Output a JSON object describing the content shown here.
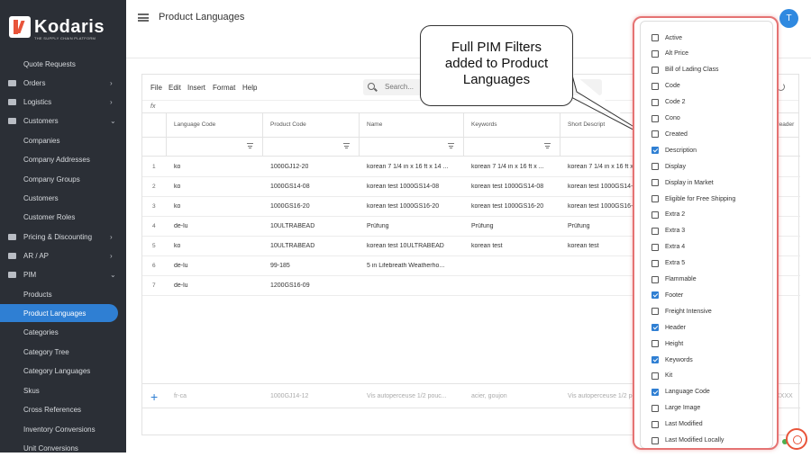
{
  "brand": {
    "name": "Kodaris",
    "tagline": "THE SUPPLY CHAIN PLATFORM",
    "accent": "#2f7fd3",
    "sidebar_bg": "#2b2f36"
  },
  "sidebar": {
    "items": [
      {
        "label": "Quote Requests",
        "icon": "",
        "chevron": "",
        "sub": true
      },
      {
        "label": "Orders",
        "icon": "cart-icon",
        "chevron": "›",
        "sub": false
      },
      {
        "label": "Logistics",
        "icon": "truck-icon",
        "chevron": "›",
        "sub": false
      },
      {
        "label": "Customers",
        "icon": "people-icon",
        "chevron": "⌄",
        "sub": false
      },
      {
        "label": "Companies",
        "icon": "",
        "chevron": "",
        "sub": true
      },
      {
        "label": "Company Addresses",
        "icon": "",
        "chevron": "",
        "sub": true
      },
      {
        "label": "Company Groups",
        "icon": "",
        "chevron": "",
        "sub": true
      },
      {
        "label": "Customers",
        "icon": "",
        "chevron": "",
        "sub": true
      },
      {
        "label": "Customer Roles",
        "icon": "",
        "chevron": "",
        "sub": true
      },
      {
        "label": "Pricing & Discounting",
        "icon": "dollar-icon",
        "chevron": "›",
        "sub": false
      },
      {
        "label": "AR / AP",
        "icon": "ledger-icon",
        "chevron": "›",
        "sub": false
      },
      {
        "label": "PIM",
        "icon": "tag-icon",
        "chevron": "⌄",
        "sub": false
      },
      {
        "label": "Products",
        "icon": "",
        "chevron": "",
        "sub": true
      },
      {
        "label": "Product Languages",
        "icon": "",
        "chevron": "",
        "sub": true,
        "active": true
      },
      {
        "label": "Categories",
        "icon": "",
        "chevron": "",
        "sub": true
      },
      {
        "label": "Category Tree",
        "icon": "",
        "chevron": "",
        "sub": true
      },
      {
        "label": "Category Languages",
        "icon": "",
        "chevron": "",
        "sub": true
      },
      {
        "label": "Skus",
        "icon": "",
        "chevron": "",
        "sub": true
      },
      {
        "label": "Cross References",
        "icon": "",
        "chevron": "",
        "sub": true
      },
      {
        "label": "Inventory Conversions",
        "icon": "",
        "chevron": "",
        "sub": true
      },
      {
        "label": "Unit Conversions",
        "icon": "",
        "chevron": "",
        "sub": true
      }
    ]
  },
  "header": {
    "title": "Product Languages",
    "avatar_initial": "T"
  },
  "toolbar": {
    "menus": [
      "File",
      "Edit",
      "Insert",
      "Format",
      "Help"
    ],
    "search_placeholder": "Search...",
    "fx_label": "fx"
  },
  "table": {
    "columns": [
      "Language Code",
      "Product Code",
      "Name",
      "Keywords",
      "Short Descript",
      "Header"
    ],
    "rows": [
      {
        "num": "1",
        "lang": "ko",
        "code": "1000GJ12-20",
        "name": "korean 7 1/4 in x 16 ft x 14 ...",
        "keywords": "korean 7 1/4 in x 16 ft x ...",
        "short": "korean 7 1/4 in x 16 ft x 1"
      },
      {
        "num": "2",
        "lang": "ko",
        "code": "1000GS14-08",
        "name": "korean test 1000GS14-08",
        "keywords": "korean test 1000GS14-08",
        "short": "korean test 1000GS14-0"
      },
      {
        "num": "3",
        "lang": "ko",
        "code": "1000GS16-20",
        "name": "korean test 1000GS16-20",
        "keywords": "korean test 1000GS16-20",
        "short": "korean test 1000GS16-2"
      },
      {
        "num": "4",
        "lang": "de-lu",
        "code": "10ULTRABEAD",
        "name": "Prüfung",
        "keywords": "Prüfung",
        "short": "Prüfung"
      },
      {
        "num": "5",
        "lang": "ko",
        "code": "10ULTRABEAD",
        "name": "korean test 10ULTRABEAD",
        "keywords": "korean test",
        "short": "korean test"
      },
      {
        "num": "6",
        "lang": "de-lu",
        "code": "99-185",
        "name": "5 in Lifebreath Weatherho...",
        "keywords": "",
        "short": ""
      },
      {
        "num": "7",
        "lang": "de-lu",
        "code": "1200GS16-09",
        "name": "",
        "keywords": "",
        "short": ""
      }
    ],
    "new_row": {
      "lang": "fr-ca",
      "code": "1000GJ14-12",
      "name": "Vis autoperceuse 1/2 pouc...",
      "keywords": "acier, goujon",
      "short": "Vis autoperceuse 1/2 pouc...",
      "header": "XXXX"
    }
  },
  "callout": {
    "line1": "Full PIM Filters",
    "line2": "added to Product",
    "line3": "Languages"
  },
  "filter_panel": {
    "options": [
      {
        "label": "Active",
        "checked": false
      },
      {
        "label": "Alt Price",
        "checked": false
      },
      {
        "label": "Bill of Lading Class",
        "checked": false
      },
      {
        "label": "Code",
        "checked": false
      },
      {
        "label": "Code 2",
        "checked": false
      },
      {
        "label": "Cono",
        "checked": false
      },
      {
        "label": "Created",
        "checked": false
      },
      {
        "label": "Description",
        "checked": true
      },
      {
        "label": "Display",
        "checked": false
      },
      {
        "label": "Display in Market",
        "checked": false
      },
      {
        "label": "Eligible for Free Shipping",
        "checked": false
      },
      {
        "label": "Extra 2",
        "checked": false
      },
      {
        "label": "Extra 3",
        "checked": false
      },
      {
        "label": "Extra 4",
        "checked": false
      },
      {
        "label": "Extra 5",
        "checked": false
      },
      {
        "label": "Flammable",
        "checked": false
      },
      {
        "label": "Footer",
        "checked": true
      },
      {
        "label": "Freight Intensive",
        "checked": false
      },
      {
        "label": "Header",
        "checked": true
      },
      {
        "label": "Height",
        "checked": false
      },
      {
        "label": "Keywords",
        "checked": true
      },
      {
        "label": "Kit",
        "checked": false
      },
      {
        "label": "Language Code",
        "checked": true
      },
      {
        "label": "Large Image",
        "checked": false
      },
      {
        "label": "Last Modified",
        "checked": false
      },
      {
        "label": "Last Modified Locally",
        "checked": false
      }
    ]
  }
}
